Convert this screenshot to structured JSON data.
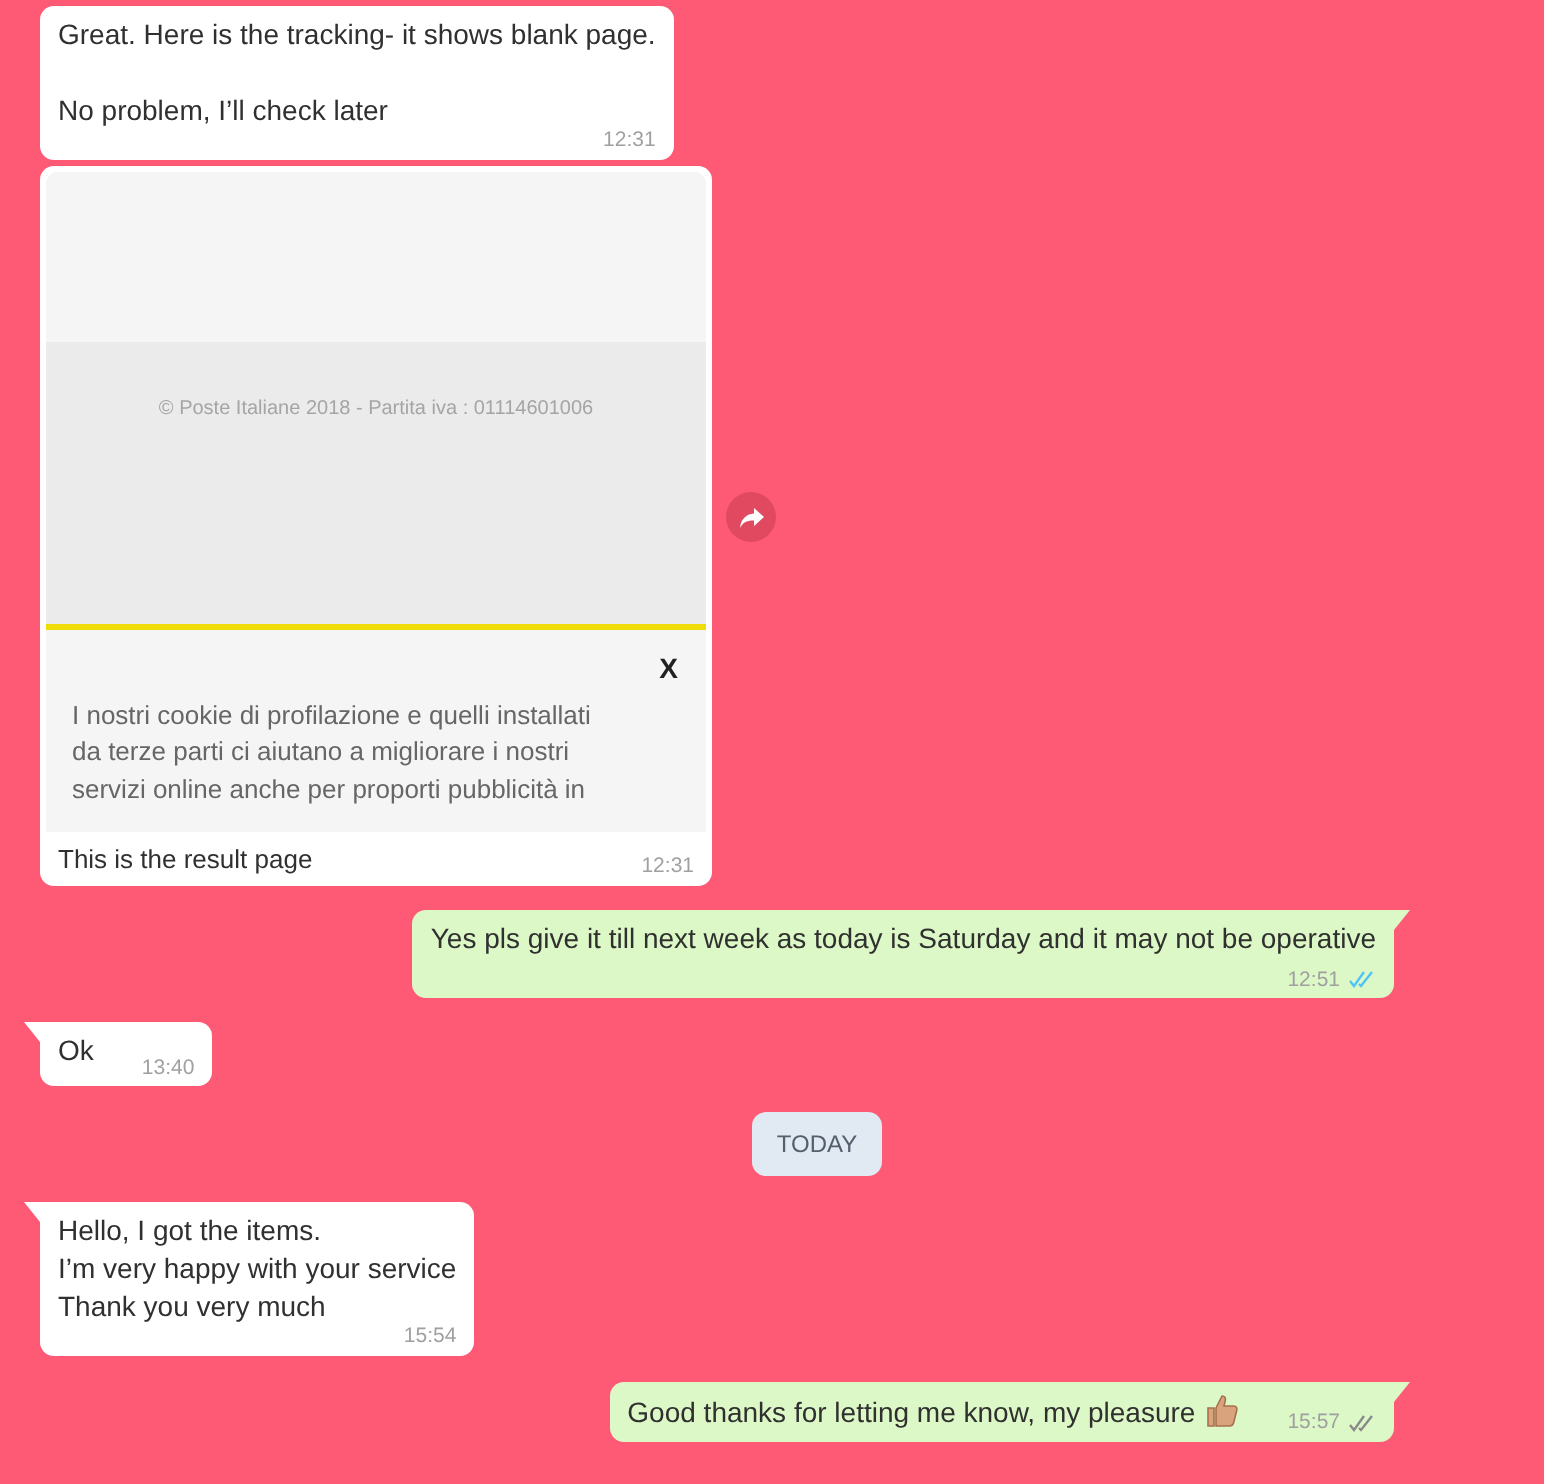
{
  "messages": [
    {
      "kind": "text",
      "outgoing": false,
      "tail": false,
      "paragraphs": [
        [
          "Great. Here is the tracking- it shows blank page."
        ],
        [
          "No problem, I’ll check later"
        ]
      ],
      "time": "12:31"
    },
    {
      "kind": "image",
      "screenshot": {
        "footer": "© Poste Italiane 2018 - Partita iva : 01114601006",
        "close": "X",
        "cookie_lines": [
          "I nostri cookie di profilazione e quelli installati",
          "da terze parti ci aiutano a migliorare i nostri",
          "servizi online anche per proporti pubblicità in"
        ]
      },
      "caption": "This is the result page",
      "time": "12:31"
    },
    {
      "kind": "text",
      "outgoing": true,
      "tail": true,
      "paragraphs": [
        [
          "Yes pls give it till next week as today is Saturday and it may not be operative"
        ]
      ],
      "time": "12:51",
      "read": true
    },
    {
      "kind": "text",
      "outgoing": false,
      "tail": true,
      "paragraphs": [
        [
          "Ok"
        ]
      ],
      "time": "13:40"
    },
    {
      "kind": "date",
      "label": "TODAY"
    },
    {
      "kind": "text",
      "outgoing": false,
      "tail": true,
      "paragraphs": [
        [
          "Hello, I got the items.",
          "I’m very happy with your service",
          "Thank you very much"
        ]
      ],
      "time": "15:54"
    },
    {
      "kind": "text",
      "outgoing": true,
      "tail": true,
      "inline": true,
      "paragraphs": [
        [
          "Good thanks for letting me know, my pleasure"
        ]
      ],
      "thumbs_up": true,
      "time": "15:57",
      "read": false
    }
  ]
}
